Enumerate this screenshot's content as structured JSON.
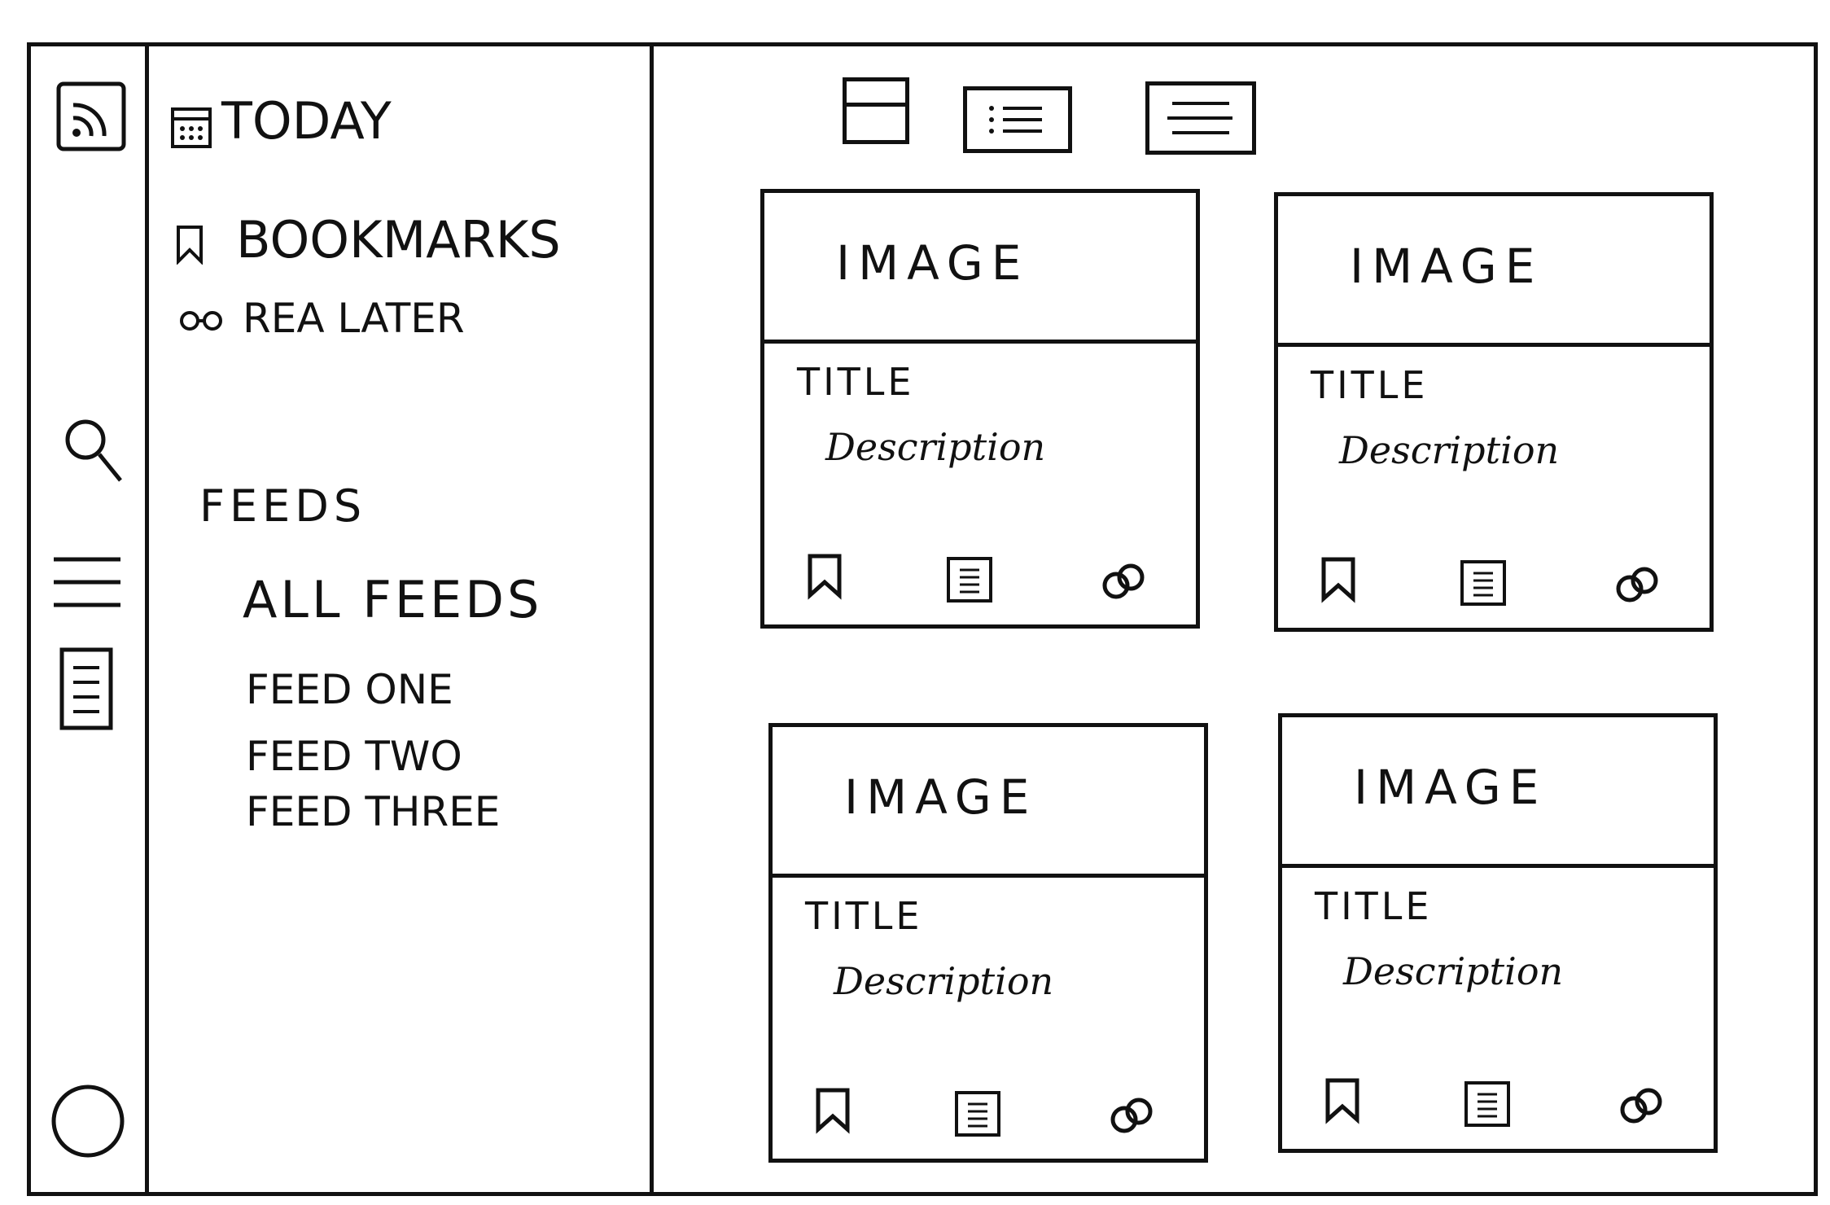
{
  "sidebar": {
    "today_label": "TODAY",
    "bookmarks_label": "BOOKMARKS",
    "read_later_label": "REA LATER",
    "feeds_heading": "FEEDS",
    "all_feeds_label": "ALL FEEDS",
    "feeds": [
      "FEED ONE",
      "FEED TWO",
      "FEED THREE"
    ]
  },
  "rail": {
    "icons": [
      "rss-icon",
      "search-icon",
      "menu-icon",
      "notes-icon",
      "profile-circle-icon"
    ]
  },
  "toolbar": {
    "views": [
      "card-view-icon",
      "list-view-icon",
      "text-view-icon"
    ]
  },
  "cards": [
    {
      "image_label": "IMAGE",
      "title": "TITLE",
      "description": "Description"
    },
    {
      "image_label": "IMAGE",
      "title": "TITLE",
      "description": "Description"
    },
    {
      "image_label": "IMAGE",
      "title": "TITLE",
      "description": "Description"
    },
    {
      "image_label": "IMAGE",
      "title": "TITLE",
      "description": "Description"
    }
  ]
}
